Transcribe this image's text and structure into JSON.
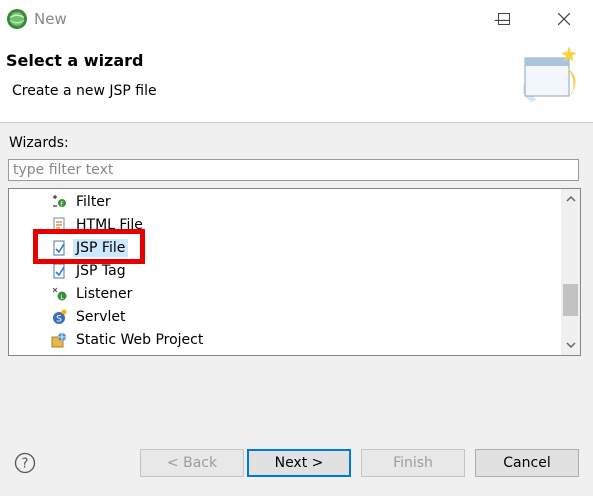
{
  "window": {
    "title": "New"
  },
  "header": {
    "title": "Select a wizard",
    "description": "Create a new JSP file"
  },
  "wizards": {
    "label": "Wizards:",
    "filter_placeholder": "type filter text",
    "items": [
      {
        "label": "Filter",
        "icon": "filter-icon"
      },
      {
        "label": "HTML File",
        "icon": "html-file-icon"
      },
      {
        "label": "JSP File",
        "icon": "jsp-file-icon",
        "selected": true
      },
      {
        "label": "JSP Tag",
        "icon": "jsp-tag-icon"
      },
      {
        "label": "Listener",
        "icon": "listener-icon"
      },
      {
        "label": "Servlet",
        "icon": "servlet-icon"
      },
      {
        "label": "Static Web Project",
        "icon": "web-project-icon"
      }
    ]
  },
  "buttons": {
    "back": "< Back",
    "next": "Next >",
    "finish": "Finish",
    "cancel": "Cancel"
  },
  "colors": {
    "selection": "#cce8ff",
    "highlight_box": "#e60000",
    "default_button_border": "#0078d7"
  }
}
